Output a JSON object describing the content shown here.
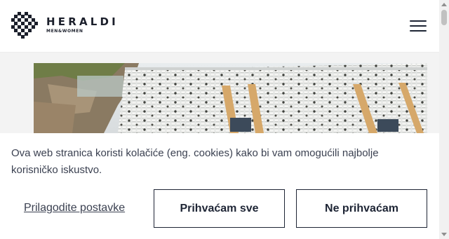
{
  "header": {
    "brand_name": "HERALDI",
    "brand_tagline": "MEN&WOMEN",
    "menu_icon": "hamburger-menu-icon"
  },
  "hero": {
    "image": "stadium-stands-photo"
  },
  "cookie_banner": {
    "message": "Ova web stranica koristi kolačiće (eng. cookies) kako bi vam omogućili najbolje korisničko iskustvo.",
    "customize_label": "Prilagodite postavke",
    "accept_label": "Prihvaćam sve",
    "decline_label": "Ne prihvaćam"
  },
  "colors": {
    "text_dark": "#1e2535",
    "text_body": "#3b4151",
    "header_bg": "#ffffff",
    "hero_bg": "#f3f3f3"
  }
}
